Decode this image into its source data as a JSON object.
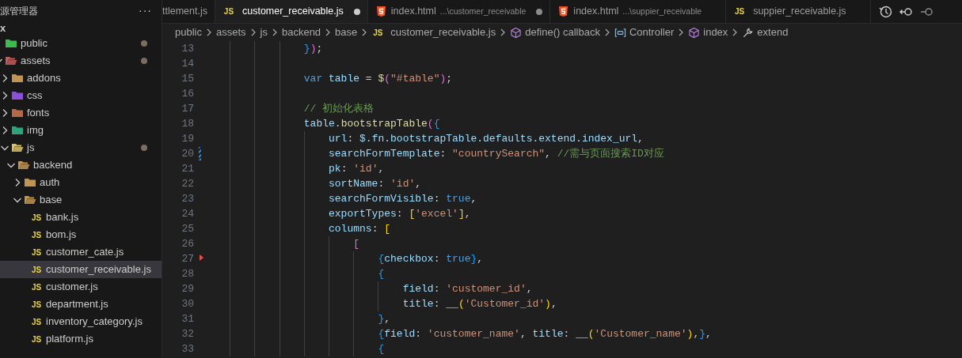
{
  "explorer": {
    "title": "源管理器",
    "more": "···",
    "root": "x",
    "tree": [
      {
        "label": "public",
        "kind": "folder",
        "color": "#3fb950",
        "modified": true,
        "selected": false
      },
      {
        "label": "assets",
        "kind": "folder",
        "color": "#c75b5b",
        "expanded": true,
        "modified": true,
        "selected": false,
        "children": [
          {
            "label": "addons",
            "kind": "folder",
            "color": "#c09553",
            "expanded": false,
            "modified": false,
            "selected": false
          },
          {
            "label": "css",
            "kind": "folder",
            "color": "#8c4fd9",
            "expanded": false,
            "modified": false,
            "selected": false
          },
          {
            "label": "fonts",
            "kind": "folder",
            "color": "#b5694a",
            "expanded": false,
            "modified": false,
            "selected": false
          },
          {
            "label": "img",
            "kind": "folder",
            "color": "#2fa37c",
            "expanded": false,
            "modified": false,
            "selected": false
          },
          {
            "label": "js",
            "kind": "folder",
            "color": "#d9c26a",
            "expanded": true,
            "modified": true,
            "selected": false,
            "children": [
              {
                "label": "backend",
                "kind": "folder",
                "color": "#c09553",
                "expanded": true,
                "modified": false,
                "selected": false,
                "children": [
                  {
                    "label": "auth",
                    "kind": "folder",
                    "color": "#c09553",
                    "expanded": false,
                    "modified": false,
                    "selected": false
                  },
                  {
                    "label": "base",
                    "kind": "folder",
                    "color": "#c09553",
                    "expanded": true,
                    "modified": false,
                    "selected": false,
                    "children": [
                      {
                        "label": "bank.js",
                        "kind": "file",
                        "icon": "JS",
                        "modified": false,
                        "selected": false
                      },
                      {
                        "label": "bom.js",
                        "kind": "file",
                        "icon": "JS",
                        "modified": false,
                        "selected": false
                      },
                      {
                        "label": "customer_cate.js",
                        "kind": "file",
                        "icon": "JS",
                        "modified": false,
                        "selected": false
                      },
                      {
                        "label": "customer_receivable.js",
                        "kind": "file",
                        "icon": "JS",
                        "modified": false,
                        "selected": true
                      },
                      {
                        "label": "customer.js",
                        "kind": "file",
                        "icon": "JS",
                        "modified": false,
                        "selected": false
                      },
                      {
                        "label": "department.js",
                        "kind": "file",
                        "icon": "JS",
                        "modified": false,
                        "selected": false
                      },
                      {
                        "label": "inventory_category.js",
                        "kind": "file",
                        "icon": "JS",
                        "modified": false,
                        "selected": false
                      },
                      {
                        "label": "platform.js",
                        "kind": "file",
                        "icon": "JS",
                        "modified": false,
                        "selected": false
                      }
                    ]
                  }
                ]
              }
            ]
          }
        ]
      }
    ]
  },
  "tabs": [
    {
      "label": "ttlement.js",
      "selected": false,
      "dirty": false
    },
    {
      "label": "customer_receivable.js",
      "kind": "js",
      "icon": "JS",
      "selected": true,
      "dirty": true
    },
    {
      "label": "index.html",
      "detail": "...\\customer_receivable",
      "kind": "html",
      "selected": false,
      "dirty": true
    },
    {
      "label": "index.html",
      "detail": "...\\suppier_receivable",
      "kind": "html",
      "selected": false,
      "dirty": false
    },
    {
      "label": "suppier_receivable.js",
      "kind": "js",
      "icon": "JS",
      "selected": false,
      "dirty": false
    }
  ],
  "breadcrumb": [
    {
      "label": "public",
      "kind": "folder"
    },
    {
      "label": "assets",
      "kind": "folder"
    },
    {
      "label": "js",
      "kind": "folder"
    },
    {
      "label": "backend",
      "kind": "folder"
    },
    {
      "label": "base",
      "kind": "folder"
    },
    {
      "label": "customer_receivable.js",
      "kind": "file",
      "icon": "JS"
    },
    {
      "label": "define() callback",
      "kind": "method"
    },
    {
      "label": "Controller",
      "kind": "variable"
    },
    {
      "label": "index",
      "kind": "method"
    },
    {
      "label": "extend",
      "kind": "property"
    }
  ],
  "code": [
    {
      "number": "13",
      "tokens": [
        {
          "text": "}",
          "kind": "b3"
        },
        {
          "text": ")",
          "kind": "b2"
        },
        {
          "text": ";",
          "kind": "p"
        }
      ]
    },
    {
      "number": "14"
    },
    {
      "number": "15",
      "tokens": [
        {
          "text": "var",
          "kind": "kw"
        },
        {
          "text": " table",
          "kind": "var"
        },
        {
          "text": " = ",
          "kind": "p"
        },
        {
          "text": "$",
          "kind": "fn"
        },
        {
          "text": "(",
          "kind": "b2"
        },
        {
          "text": "\"#table\"",
          "kind": "str"
        },
        {
          "text": ")",
          "kind": "b2"
        },
        {
          "text": ";",
          "kind": "p"
        }
      ]
    },
    {
      "number": "16"
    },
    {
      "number": "17",
      "tokens": [
        {
          "text": "// 初始化表格",
          "kind": "cmt"
        }
      ]
    },
    {
      "number": "18",
      "tokens": [
        {
          "text": "table",
          "kind": "var"
        },
        {
          "text": ".",
          "kind": "p"
        },
        {
          "text": "bootstrapTable",
          "kind": "fn"
        },
        {
          "text": "(",
          "kind": "b2"
        },
        {
          "text": "{",
          "kind": "b3"
        }
      ],
      "children": [
        {
          "number": "19",
          "tokens": [
            {
              "text": "url",
              "kind": "var"
            },
            {
              "text": ": ",
              "kind": "p"
            },
            {
              "text": "$.fn.bootstrapTable.defaults.extend.index_url",
              "kind": "var"
            },
            {
              "text": ",",
              "kind": "p"
            }
          ]
        },
        {
          "number": "20",
          "kind": "modified",
          "tokens": [
            {
              "text": "searchFormTemplate",
              "kind": "var"
            },
            {
              "text": ": ",
              "kind": "p"
            },
            {
              "text": "\"countrySearch\"",
              "kind": "str"
            },
            {
              "text": ", ",
              "kind": "p"
            },
            {
              "text": "//需与页面搜索ID对应",
              "kind": "cmt"
            }
          ]
        },
        {
          "number": "21",
          "tokens": [
            {
              "text": "pk",
              "kind": "var"
            },
            {
              "text": ": ",
              "kind": "p"
            },
            {
              "text": "'id'",
              "kind": "str"
            },
            {
              "text": ",",
              "kind": "p"
            }
          ]
        },
        {
          "number": "22",
          "tokens": [
            {
              "text": "sortName",
              "kind": "var"
            },
            {
              "text": ": ",
              "kind": "p"
            },
            {
              "text": "'id'",
              "kind": "str"
            },
            {
              "text": ",",
              "kind": "p"
            }
          ]
        },
        {
          "number": "23",
          "tokens": [
            {
              "text": "searchFormVisible",
              "kind": "var"
            },
            {
              "text": ": ",
              "kind": "p"
            },
            {
              "text": "true",
              "kind": "kw"
            },
            {
              "text": ",",
              "kind": "p"
            }
          ]
        },
        {
          "number": "24",
          "tokens": [
            {
              "text": "exportTypes",
              "kind": "var"
            },
            {
              "text": ": ",
              "kind": "p"
            },
            {
              "text": "[",
              "kind": "b1"
            },
            {
              "text": "'excel'",
              "kind": "str"
            },
            {
              "text": "]",
              "kind": "b1"
            },
            {
              "text": ",",
              "kind": "p"
            }
          ]
        },
        {
          "number": "25",
          "tokens": [
            {
              "text": "columns",
              "kind": "var"
            },
            {
              "text": ": ",
              "kind": "p"
            },
            {
              "text": "[",
              "kind": "b1"
            }
          ],
          "children": [
            {
              "number": "26",
              "tokens": [
                {
                  "text": "[",
                  "kind": "b2"
                }
              ],
              "children": [
                {
                  "number": "27",
                  "kind": "error",
                  "tokens": [
                    {
                      "text": "{",
                      "kind": "b3"
                    },
                    {
                      "text": "checkbox",
                      "kind": "var"
                    },
                    {
                      "text": ": ",
                      "kind": "p"
                    },
                    {
                      "text": "true",
                      "kind": "kw"
                    },
                    {
                      "text": "}",
                      "kind": "b3"
                    },
                    {
                      "text": ",",
                      "kind": "p"
                    }
                  ]
                },
                {
                  "number": "28",
                  "tokens": [
                    {
                      "text": "{",
                      "kind": "b3"
                    }
                  ],
                  "children": [
                    {
                      "number": "29",
                      "tokens": [
                        {
                          "text": "field",
                          "kind": "var"
                        },
                        {
                          "text": ": ",
                          "kind": "p"
                        },
                        {
                          "text": "'customer_id'",
                          "kind": "str"
                        },
                        {
                          "text": ",",
                          "kind": "p"
                        }
                      ]
                    },
                    {
                      "number": "30",
                      "tokens": [
                        {
                          "text": "title",
                          "kind": "var"
                        },
                        {
                          "text": ": ",
                          "kind": "p"
                        },
                        {
                          "text": "__",
                          "kind": "fn"
                        },
                        {
                          "text": "(",
                          "kind": "b1"
                        },
                        {
                          "text": "'Customer_id'",
                          "kind": "str"
                        },
                        {
                          "text": ")",
                          "kind": "b1"
                        },
                        {
                          "text": ",",
                          "kind": "p"
                        }
                      ]
                    }
                  ]
                },
                {
                  "number": "31",
                  "tokens": [
                    {
                      "text": "}",
                      "kind": "b3"
                    },
                    {
                      "text": ",",
                      "kind": "p"
                    }
                  ]
                },
                {
                  "number": "32",
                  "tokens": [
                    {
                      "text": "{",
                      "kind": "b3"
                    },
                    {
                      "text": "field",
                      "kind": "var"
                    },
                    {
                      "text": ": ",
                      "kind": "p"
                    },
                    {
                      "text": "'customer_name'",
                      "kind": "str"
                    },
                    {
                      "text": ", ",
                      "kind": "p"
                    },
                    {
                      "text": "title",
                      "kind": "var"
                    },
                    {
                      "text": ": ",
                      "kind": "p"
                    },
                    {
                      "text": "__",
                      "kind": "fn"
                    },
                    {
                      "text": "(",
                      "kind": "b1"
                    },
                    {
                      "text": "'Customer_name'",
                      "kind": "str"
                    },
                    {
                      "text": ")",
                      "kind": "b1"
                    },
                    {
                      "text": ",",
                      "kind": "p"
                    },
                    {
                      "text": "}",
                      "kind": "b3"
                    },
                    {
                      "text": ",",
                      "kind": "p"
                    }
                  ]
                },
                {
                  "number": "33",
                  "tokens": [
                    {
                      "text": "{",
                      "kind": "b3"
                    }
                  ]
                }
              ]
            }
          ]
        }
      ]
    }
  ]
}
